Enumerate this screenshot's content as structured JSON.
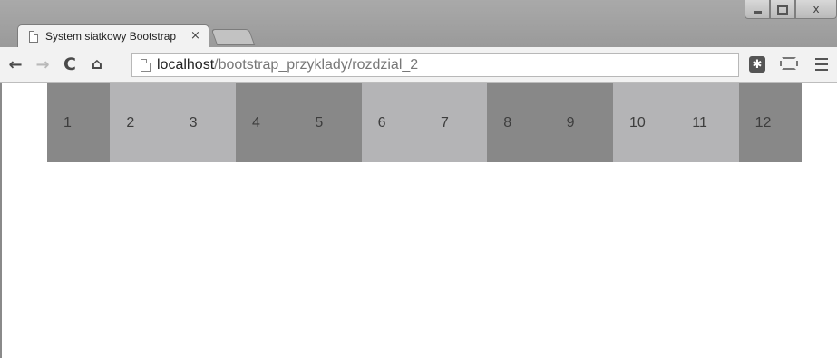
{
  "browser": {
    "tab": {
      "title": "System siatkowy Bootstrap",
      "close_glyph": "×"
    },
    "window_controls": {
      "close_glyph": "x"
    },
    "toolbar": {
      "back_glyph": "←",
      "forward_glyph": "→",
      "reload_glyph": "C",
      "home_glyph": "⌂",
      "extension_glyph": "✱"
    },
    "address_bar": {
      "host": "localhost",
      "path": "/bootstrap_przyklady/rozdzial_2"
    },
    "icons": [
      "page-icon",
      "back-arrow-icon",
      "forward-arrow-icon",
      "reload-icon",
      "home-icon",
      "extension-icon",
      "cast-icon",
      "menu-icon"
    ]
  },
  "page": {
    "columns": [
      {
        "label": "1",
        "shade": "dark"
      },
      {
        "label": "2",
        "shade": "light"
      },
      {
        "label": "3",
        "shade": "light"
      },
      {
        "label": "4",
        "shade": "dark"
      },
      {
        "label": "5",
        "shade": "dark"
      },
      {
        "label": "6",
        "shade": "light"
      },
      {
        "label": "7",
        "shade": "light"
      },
      {
        "label": "8",
        "shade": "dark"
      },
      {
        "label": "9",
        "shade": "dark"
      },
      {
        "label": "10",
        "shade": "light"
      },
      {
        "label": "11",
        "shade": "light"
      },
      {
        "label": "12",
        "shade": "dark"
      }
    ]
  },
  "colors": {
    "dark_column": "#888888",
    "light_column": "#b4b4b6",
    "chrome_frame": "#9a9a9a",
    "toolbar": "#f2f2f2"
  }
}
